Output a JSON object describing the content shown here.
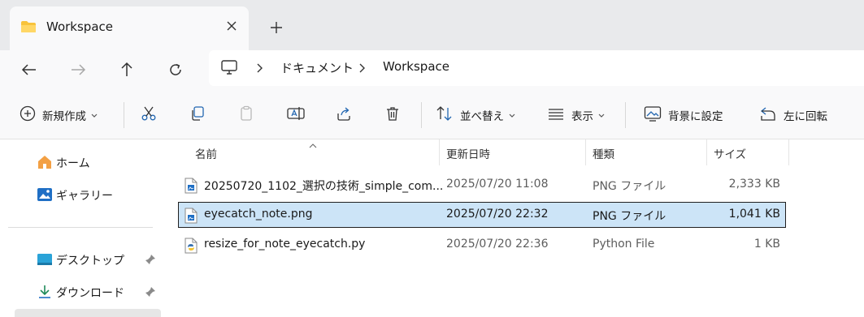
{
  "tab": {
    "title": "Workspace",
    "close_icon": "close-icon",
    "new_tab_icon": "plus-icon"
  },
  "nav": {
    "back_icon": "arrow-left-icon",
    "forward_icon": "arrow-right-icon",
    "up_icon": "arrow-up-icon",
    "refresh_icon": "refresh-icon"
  },
  "address": {
    "breadcrumbs": [
      "ドキュメント",
      "Workspace"
    ]
  },
  "toolbar": {
    "new_label": "新規作成",
    "sort_label": "並べ替え",
    "view_label": "表示",
    "set_background_label": "背景に設定",
    "rotate_left_label": "左に回転"
  },
  "sidebar": {
    "items": [
      {
        "label": "ホーム",
        "icon": "home-icon"
      },
      {
        "label": "ギャラリー",
        "icon": "gallery-icon"
      },
      {
        "label": "デスクトップ",
        "icon": "desktop-icon",
        "pinned": true
      },
      {
        "label": "ダウンロード",
        "icon": "download-icon",
        "pinned": true
      }
    ]
  },
  "columns": {
    "name": "名前",
    "modified": "更新日時",
    "type": "種類",
    "size": "サイズ"
  },
  "files": [
    {
      "name": "20250720_1102_選択の技術_simple_com...",
      "modified": "2025/07/20 11:08",
      "type": "PNG ファイル",
      "size": "2,333 KB",
      "icon": "png-file-icon",
      "selected": false
    },
    {
      "name": "eyecatch_note.png",
      "modified": "2025/07/20 22:32",
      "type": "PNG ファイル",
      "size": "1,041 KB",
      "icon": "png-file-icon",
      "selected": true
    },
    {
      "name": "resize_for_note_eyecatch.py",
      "modified": "2025/07/20 22:36",
      "type": "Python File",
      "size": "1 KB",
      "icon": "python-file-icon",
      "selected": false
    }
  ],
  "colors": {
    "accent": "#0067c0",
    "selection": "#cce4f7",
    "folder": "#f8c33c"
  }
}
